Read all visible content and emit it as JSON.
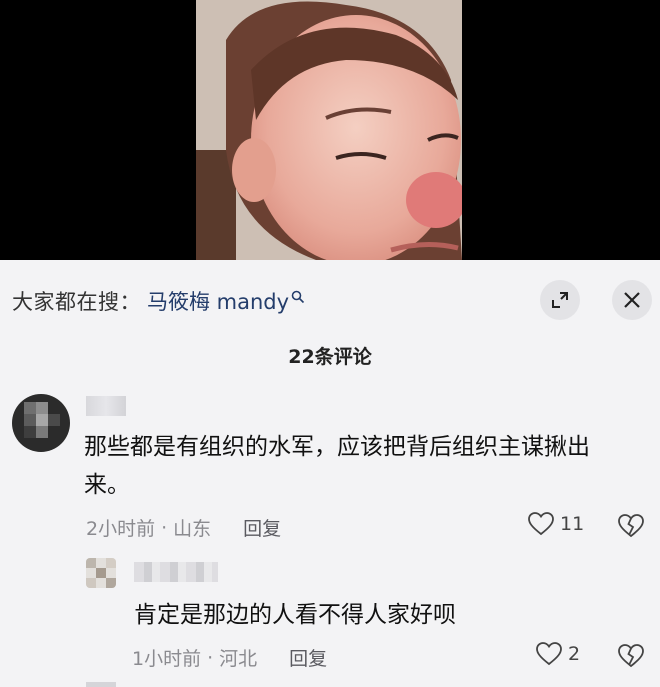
{
  "video": {
    "description_icon": "video-frame"
  },
  "header": {
    "search_prefix": "大家都在搜：",
    "search_term": "马筱梅 mandy",
    "expand_icon": "expand-icon",
    "close_icon": "close-icon"
  },
  "comments_header": {
    "count_label": "22条评论"
  },
  "comments": [
    {
      "text_line1": "那些都是有组织的水军，应该把背后组织主谋揪出",
      "text_line2": "来。",
      "time": "2小时前",
      "location": "山东",
      "reply_label": "回复",
      "likes": "11"
    }
  ],
  "replies": [
    {
      "text": "肯定是那边的人看不得人家好呗",
      "time": "1小时前",
      "location": "河北",
      "reply_label": "回复",
      "likes": "2"
    }
  ],
  "separator": "·",
  "colors": {
    "accent_search": "#243d6b",
    "sheet_bg": "#f3f3f5"
  }
}
